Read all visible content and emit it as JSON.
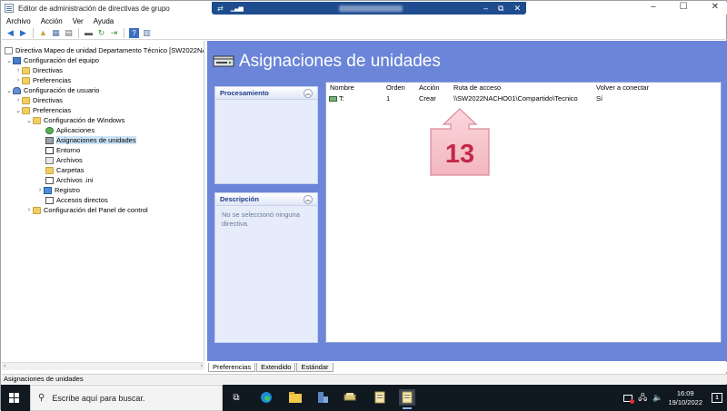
{
  "window": {
    "title": "Editor de administración de directivas de grupo"
  },
  "menu": [
    "Archivo",
    "Acción",
    "Ver",
    "Ayuda"
  ],
  "tree": {
    "root": "Directiva Mapeo de unidad Departamento Técnico [SW2022NACI",
    "nodes": [
      {
        "label": "Configuración del equipo"
      },
      {
        "label": "Directivas"
      },
      {
        "label": "Preferencias"
      },
      {
        "label": "Configuración de usuario"
      },
      {
        "label": "Directivas"
      },
      {
        "label": "Preferencias"
      },
      {
        "label": "Configuración de Windows"
      },
      {
        "label": "Aplicaciones"
      },
      {
        "label": "Asignaciones de unidades"
      },
      {
        "label": "Entorno"
      },
      {
        "label": "Archivos"
      },
      {
        "label": "Carpetas"
      },
      {
        "label": "Archivos .ini"
      },
      {
        "label": "Registro"
      },
      {
        "label": "Accesos directos"
      },
      {
        "label": "Configuración del Panel de control"
      }
    ]
  },
  "main": {
    "title": "Asignaciones de unidades",
    "processing_title": "Procesamiento",
    "description_title": "Descripción",
    "description_text": "No se seleccionó ninguna directiva.",
    "columns": [
      "Nombre",
      "Orden",
      "Acción",
      "Ruta de acceso",
      "Volver a conectar"
    ],
    "rows": [
      {
        "name": "T:",
        "order": "1",
        "action": "Crear",
        "path": "\\\\SW2022NACHO01\\Compartido\\Tecnico",
        "reconnect": "Sí"
      }
    ],
    "callout_number": "13"
  },
  "tabs": [
    "Preferencias",
    "Extendido",
    "Estándar"
  ],
  "status": "Asignaciones de unidades",
  "taskbar": {
    "search_placeholder": "Escribe aquí para buscar.",
    "time": "16:09",
    "date": "19/10/2022",
    "notifications": "1"
  },
  "colors": {
    "panel_blue": "#6b85d8",
    "callout_pink": "#f7c4cb",
    "callout_text": "#c22848"
  }
}
